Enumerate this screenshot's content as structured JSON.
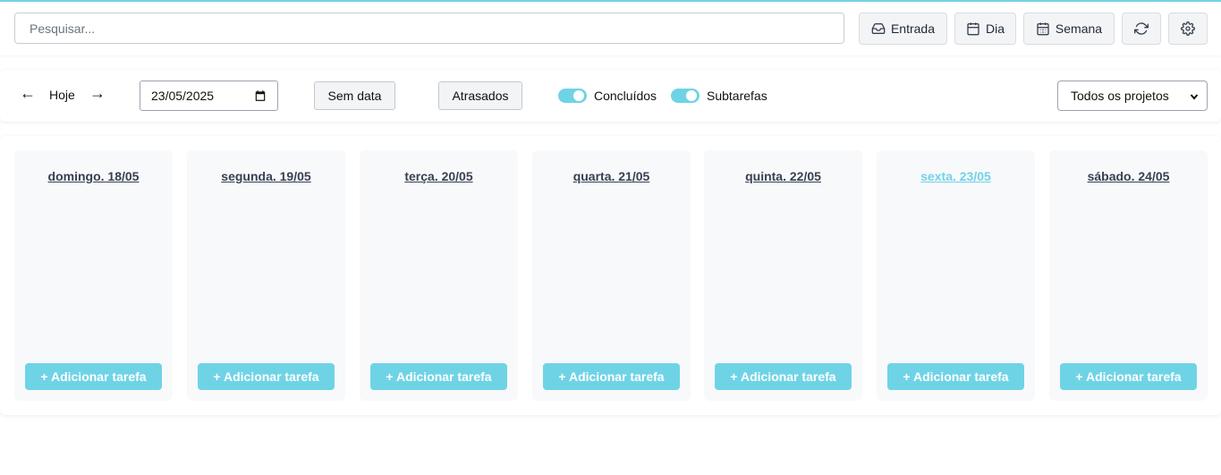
{
  "theme": {
    "accent": "#6fd3e6"
  },
  "toolbar": {
    "search_placeholder": "Pesquisar...",
    "inbox_label": "Entrada",
    "inbox_icon": "inbox-icon",
    "day_label": "Dia",
    "day_icon": "calendar-icon",
    "week_label": "Semana",
    "week_icon": "calendar-week-icon",
    "refresh_icon": "refresh-icon",
    "settings_icon": "gear-icon"
  },
  "nav": {
    "prev_arrow": "←",
    "today_label": "Hoje",
    "next_arrow": "→",
    "date_value": "23/05/2025",
    "no_date_label": "Sem data",
    "overdue_label": "Atrasados",
    "completed_label": "Concluídos",
    "completed_on": true,
    "subtasks_label": "Subtarefas",
    "subtasks_on": true,
    "project_select": "Todos os projetos"
  },
  "board": {
    "add_task_label": "+ Adicionar tarefa",
    "days": [
      {
        "label": "domingo. 18/05",
        "today": false
      },
      {
        "label": "segunda. 19/05",
        "today": false
      },
      {
        "label": "terça. 20/05",
        "today": false
      },
      {
        "label": "quarta. 21/05",
        "today": false
      },
      {
        "label": "quinta. 22/05",
        "today": false
      },
      {
        "label": "sexta. 23/05",
        "today": true
      },
      {
        "label": "sábado. 24/05",
        "today": false
      }
    ]
  }
}
